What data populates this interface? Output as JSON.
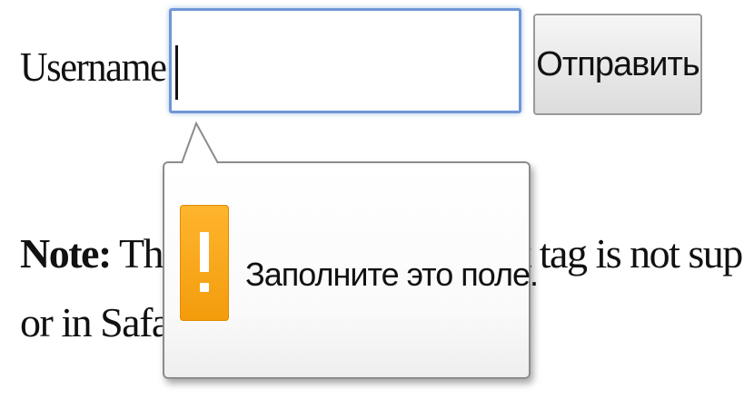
{
  "form": {
    "username_label": "Username:",
    "username_value": "",
    "submit_label": "Отправить"
  },
  "note": {
    "bold_prefix": "Note:",
    "text_left": " The ",
    "text_right": "ut tag is not sup",
    "line2": "or in Safar"
  },
  "validation": {
    "message": "Заполните это поле.",
    "icon": "warning-icon",
    "icon_color": "#f5a11a"
  },
  "colors": {
    "input_focus_border": "#6f97d6"
  }
}
